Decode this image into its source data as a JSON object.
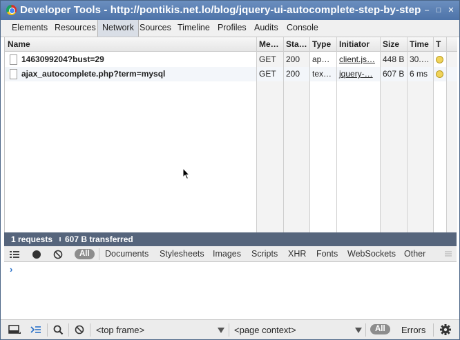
{
  "window": {
    "title": "Developer Tools - http://pontikis.net.lo/blog/jquery-ui-autocomplete-step-by-step",
    "controls": [
      "↑",
      "–",
      "□",
      "✕"
    ]
  },
  "tabs": [
    {
      "label": "Elements"
    },
    {
      "label": "Resources"
    },
    {
      "label": "Network",
      "active": true
    },
    {
      "label": "Sources"
    },
    {
      "label": "Timeline"
    },
    {
      "label": "Profiles"
    },
    {
      "label": "Audits"
    },
    {
      "label": "Console"
    }
  ],
  "network": {
    "columns": [
      "Name",
      "Me…",
      "Sta…",
      "Type",
      "Initiator",
      "Size",
      "Time",
      "T"
    ],
    "rows": [
      {
        "name": "1463099204?bust=29",
        "method": "GET",
        "status": "200",
        "type": "ap…",
        "initiator": "client.js…",
        "size": "448 B",
        "time": "30.…"
      },
      {
        "name": "ajax_autocomplete.php?term=mysql",
        "method": "GET",
        "status": "200",
        "type": "tex…",
        "initiator": "jquery-…",
        "size": "607 B",
        "time": "6 ms"
      }
    ],
    "summary": {
      "requests": "1 requests",
      "transferred": "607 B transferred"
    }
  },
  "filters": {
    "all": "All",
    "items": [
      "Documents",
      "Stylesheets",
      "Images",
      "Scripts",
      "XHR",
      "Fonts",
      "WebSockets",
      "Other"
    ]
  },
  "console": {
    "prompt": "›"
  },
  "bottom": {
    "frame_select": "<top frame>",
    "context_select": "<page context>",
    "all": "All",
    "errors": "Errors"
  },
  "colors": {
    "summary_bar": "#56657c",
    "titlebar": "#5a7fb3",
    "prompt": "#2b72c9"
  }
}
